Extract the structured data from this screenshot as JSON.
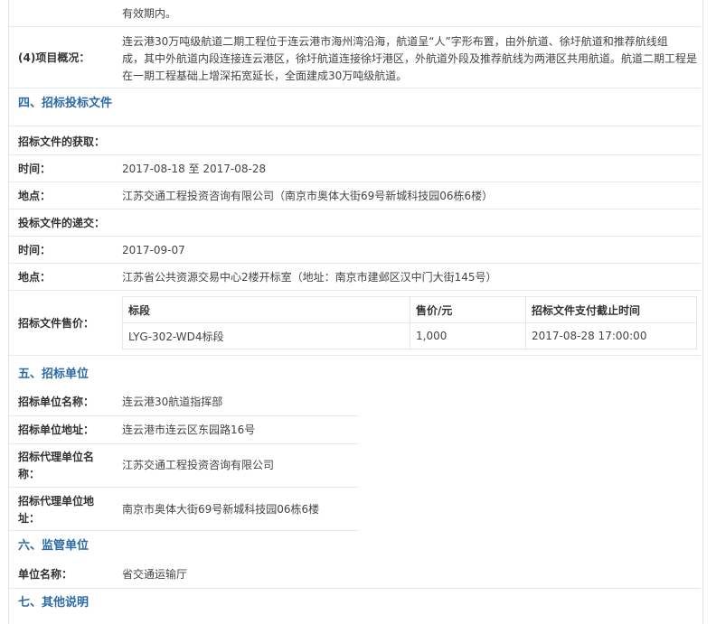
{
  "intro": {
    "tail_text": "有效期内。"
  },
  "project": {
    "label": "(4)项目概况：",
    "text_line1": "连云港30万吨级航道二期工程位于连云港市海州湾沿海，航道呈“人”字形布置，由外航道、徐圩航道和推荐航线组",
    "text_line2": "成，其中外航道内段连接连云港区，徐圩航道连接徐圩港区，外航道外段及推荐航线为两港区共用航道。航道二期工程是",
    "text_line3": "在一期工程基础上增深拓宽延长，全面建成30万吨级航道。"
  },
  "section4": {
    "title": "四、招标投标文件",
    "obtain_label": "招标文件的获取：",
    "time_label": "时间：",
    "time_value": "2017-08-18 至 2017-08-28",
    "place_label": "地点：",
    "place_value": "江苏交通工程投资咨询有限公司（南京市奥体大街69号新城科技园06栋6楼）",
    "submit_label": "投标文件的递交：",
    "submit_time_label": "时间：",
    "submit_time_value": "2017-09-07",
    "submit_place_label": "地点：",
    "submit_place_value": "江苏省公共资源交易中心2楼开标室（地址：南京市建邺区汉中门大街145号）",
    "price_label": "招标文件售价：",
    "table": {
      "headers": [
        "标段",
        "售价/元",
        "招标文件支付截止时间"
      ],
      "rows": [
        [
          "LYG-302-WD4标段",
          "1,000",
          "2017-08-28 17:00:00"
        ]
      ]
    }
  },
  "section5": {
    "title": "五、招标单位",
    "name_label": "招标单位名称：",
    "name_value": "连云港30航道指挥部",
    "addr_label": "招标单位地址：",
    "addr_value": "连云港市连云区东园路16号",
    "agent_name_label_line1": "招标代理单位名",
    "agent_name_label_line2": "称：",
    "agent_name_value": "江苏交通工程投资咨询有限公司",
    "agent_addr_label_line1": "招标代理单位地",
    "agent_addr_label_line2": "址：",
    "agent_addr_value": "南京市奥体大街69号新城科技园06栋6楼"
  },
  "section6": {
    "title": "六、监管单位",
    "unit_label": "单位名称：",
    "unit_value": "省交通运输厅"
  },
  "section7": {
    "title": "七、其他说明"
  }
}
